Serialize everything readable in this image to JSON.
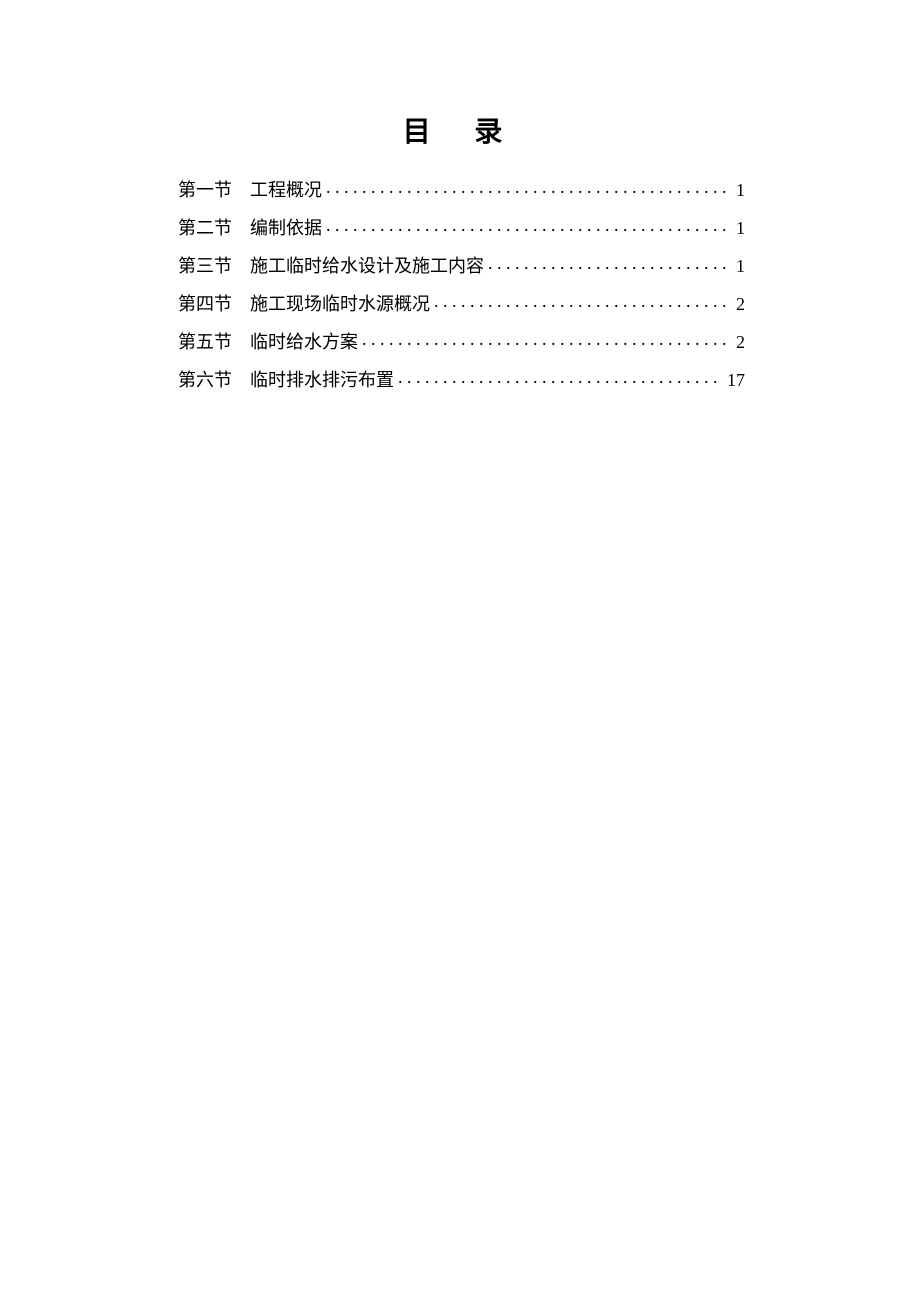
{
  "title": "目 录",
  "toc": [
    {
      "section": "第一节",
      "name": "工程概况",
      "page": "1"
    },
    {
      "section": "第二节",
      "name": "编制依据",
      "page": "1"
    },
    {
      "section": "第三节",
      "name": "施工临时给水设计及施工内容",
      "page": "1"
    },
    {
      "section": "第四节",
      "name": "施工现场临时水源概况",
      "page": "2"
    },
    {
      "section": "第五节",
      "name": "临时给水方案",
      "page": "2"
    },
    {
      "section": "第六节",
      "name": "临时排水排污布置",
      "page": "17"
    }
  ]
}
